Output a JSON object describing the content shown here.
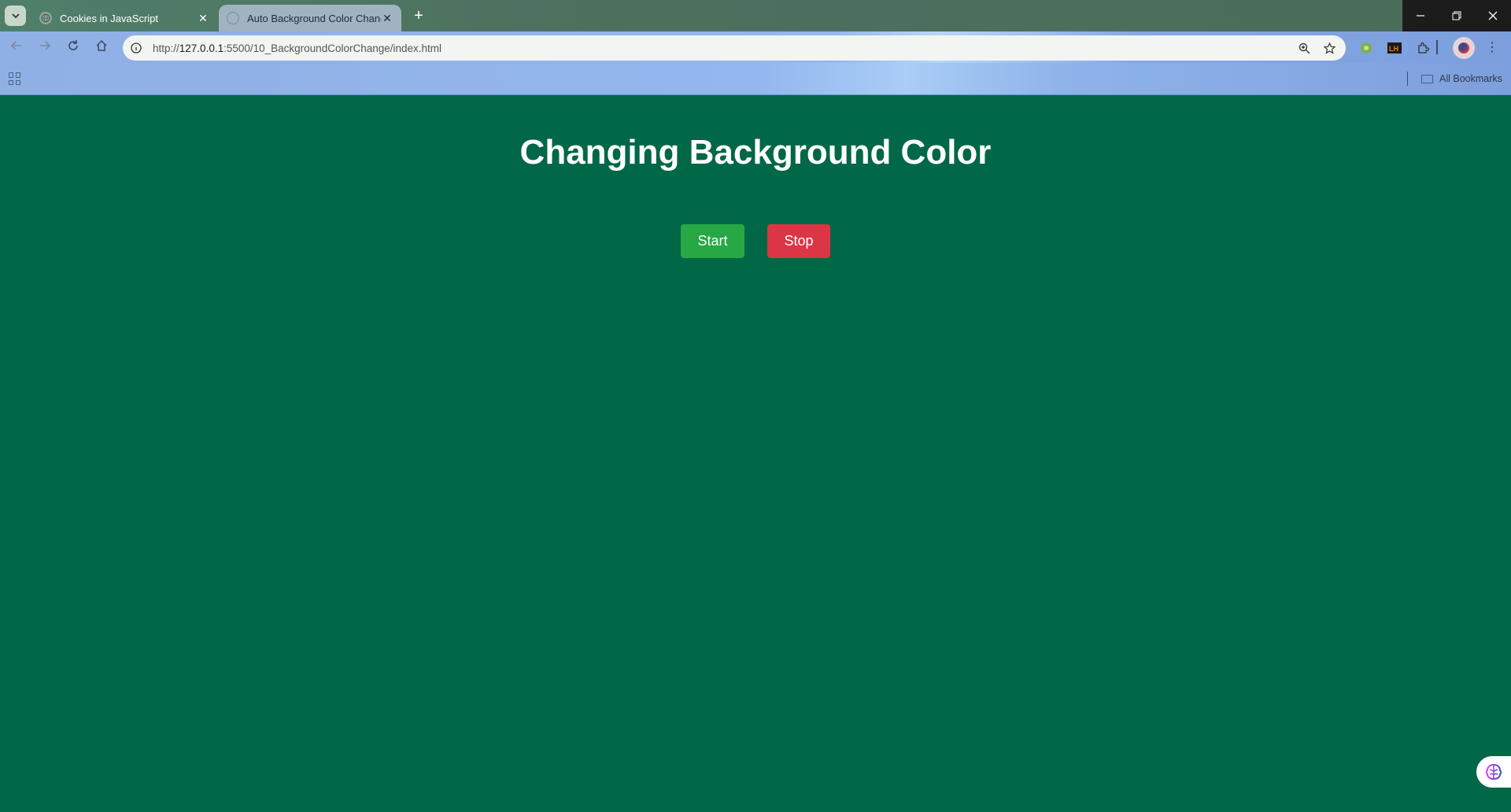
{
  "browser": {
    "tabs": [
      {
        "title": "Cookies in JavaScript",
        "active": false
      },
      {
        "title": "Auto Background Color Change",
        "active": true
      }
    ],
    "new_tab_label": "+",
    "url_prefix": "http://",
    "url_host": "127.0.0.1",
    "url_rest": ":5500/10_BackgroundColorChange/index.html",
    "bookmarks_label": "All Bookmarks"
  },
  "page": {
    "title": "Changing Background Color",
    "start_label": "Start",
    "stop_label": "Stop",
    "background_color": "#006747"
  },
  "colors": {
    "start_button": "#28a745",
    "stop_button": "#dc3545"
  }
}
